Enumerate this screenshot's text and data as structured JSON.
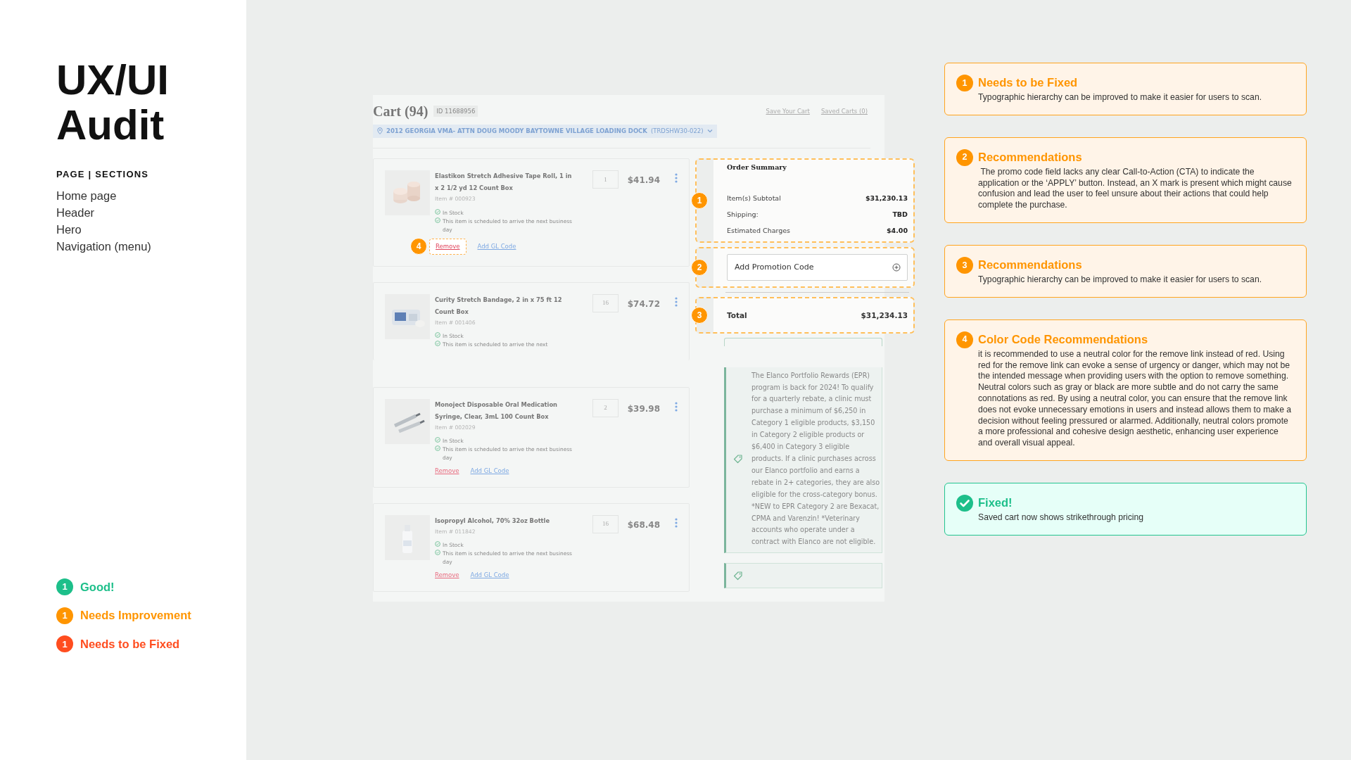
{
  "sidebar": {
    "title_lines": [
      "UX/UI",
      "Audit"
    ],
    "section_heading": "PAGE | SECTIONS",
    "sections": [
      "Home page",
      "Header",
      "Hero",
      "Navigation (menu)"
    ]
  },
  "legend": [
    {
      "count": "1",
      "label": "Good!",
      "color": "#1dbf8a"
    },
    {
      "count": "1",
      "label": "Needs Improvement",
      "color": "#ff9500"
    },
    {
      "count": "1",
      "label": "Needs to be Fixed",
      "color": "#ff4d1f"
    }
  ],
  "cart": {
    "title": "Cart (94)",
    "cart_id": "ID 11688956",
    "header_links": [
      "Save Your Cart",
      "Saved Carts (0)"
    ],
    "address": "2012 GEORGIA VMA- ATTN DOUG MOODY  BAYTOWNE VILLAGE LOADING DOCK",
    "address_code": "(TRDSHW30-022)",
    "items": [
      {
        "name": "Elastikon Stretch Adhesive Tape Roll, 1 in x 2 1/2 yd 12 Count Box",
        "item_no": "Item # 000923",
        "quantity": "1",
        "price": "$41.94",
        "stock": "In Stock",
        "delivery": "This item is scheduled to arrive the next business day",
        "actions": [
          "Remove",
          "Add GL Code"
        ],
        "marker": "4"
      },
      {
        "name": "Curity Stretch Bandage, 2 in x 75 ft 12 Count Box",
        "item_no": "Item # 001406",
        "quantity": "16",
        "price": "$74.72",
        "stock": "In Stock",
        "delivery": "This item is scheduled to arrive the next"
      },
      {
        "name": "Monoject Disposable Oral Medication Syringe, Clear, 3mL 100 Count Box",
        "item_no": "Item # 002029",
        "quantity": "2",
        "price": "$39.98",
        "stock": "In Stock",
        "delivery": "This item is scheduled to arrive the next business day",
        "actions": [
          "Remove",
          "Add GL Code"
        ]
      },
      {
        "name": "Isopropyl Alcohol, 70% 32oz Bottle",
        "item_no": "Item # 011842",
        "quantity": "16",
        "price": "$68.48",
        "stock": "In Stock",
        "delivery": "This item is scheduled to arrive the next business day",
        "actions": [
          "Remove",
          "Add GL Code"
        ]
      }
    ],
    "order_summary": {
      "title": "Order Summary",
      "marker": "1",
      "rows": [
        {
          "label": "Item(s) Subtotal",
          "value": "$31,230.13"
        },
        {
          "label": "Shipping:",
          "value": "TBD"
        },
        {
          "label": "Estimated Charges",
          "value": "$4.00"
        }
      ],
      "promo": {
        "placeholder": "Add Promotion Code",
        "marker": "2"
      },
      "total": {
        "label": "Total",
        "value": "$31,234.13",
        "marker": "3"
      }
    },
    "rewards_note": "The Elanco Portfolio Rewards (EPR) program is back for 2024! To qualify for a quarterly rebate, a clinic must purchase a minimum of $6,250 in Category 1 eligible products, $3,150 in Category 2 eligible products or $6,400 in Category 3 eligible products. If a clinic purchases across our Elanco portfolio and earns a rebate in 2+ categories, they are also eligible for the cross-category bonus. *NEW to EPR Category 2 are Bexacat, CPMA and Varenzin! *Veterinary accounts who operate under a contract with Elanco are not eligible."
  },
  "annotations": [
    {
      "kind": "issue",
      "marker": "1",
      "title": "Needs to be Fixed",
      "text": "Typographic hierarchy can be improved to make it easier for users to scan."
    },
    {
      "kind": "issue",
      "marker": "2",
      "title": "Recommendations",
      "text": " The promo code field lacks any clear Call-to-Action (CTA) to indicate the application or the ‘APPLY’ button. Instead, an X mark is present which might cause confusion and lead the user to feel unsure about their actions that could help complete the purchase."
    },
    {
      "kind": "issue",
      "marker": "3",
      "title": "Recommendations",
      "text": "Typographic hierarchy can be improved to make it easier for users to scan."
    },
    {
      "kind": "issue",
      "marker": "4",
      "title": "Color Code Recommendations",
      "text": "it is recommended to use a neutral color for the remove link instead of red. Using red for the remove link can evoke a sense of urgency or danger, which may not be the intended message when providing users with the option to remove something. Neutral colors such as gray or black are more subtle and do not carry the same connotations as red. By using a neutral color, you can ensure that the remove link does not evoke unnecessary emotions in users and instead allows them to make a decision without feeling pressured or alarmed. Additionally, neutral colors promote a more professional and cohesive design aesthetic, enhancing user experience and overall visual appeal."
    },
    {
      "kind": "fixed",
      "title": "Fixed!",
      "text": "Saved cart now shows strikethrough pricing"
    }
  ]
}
